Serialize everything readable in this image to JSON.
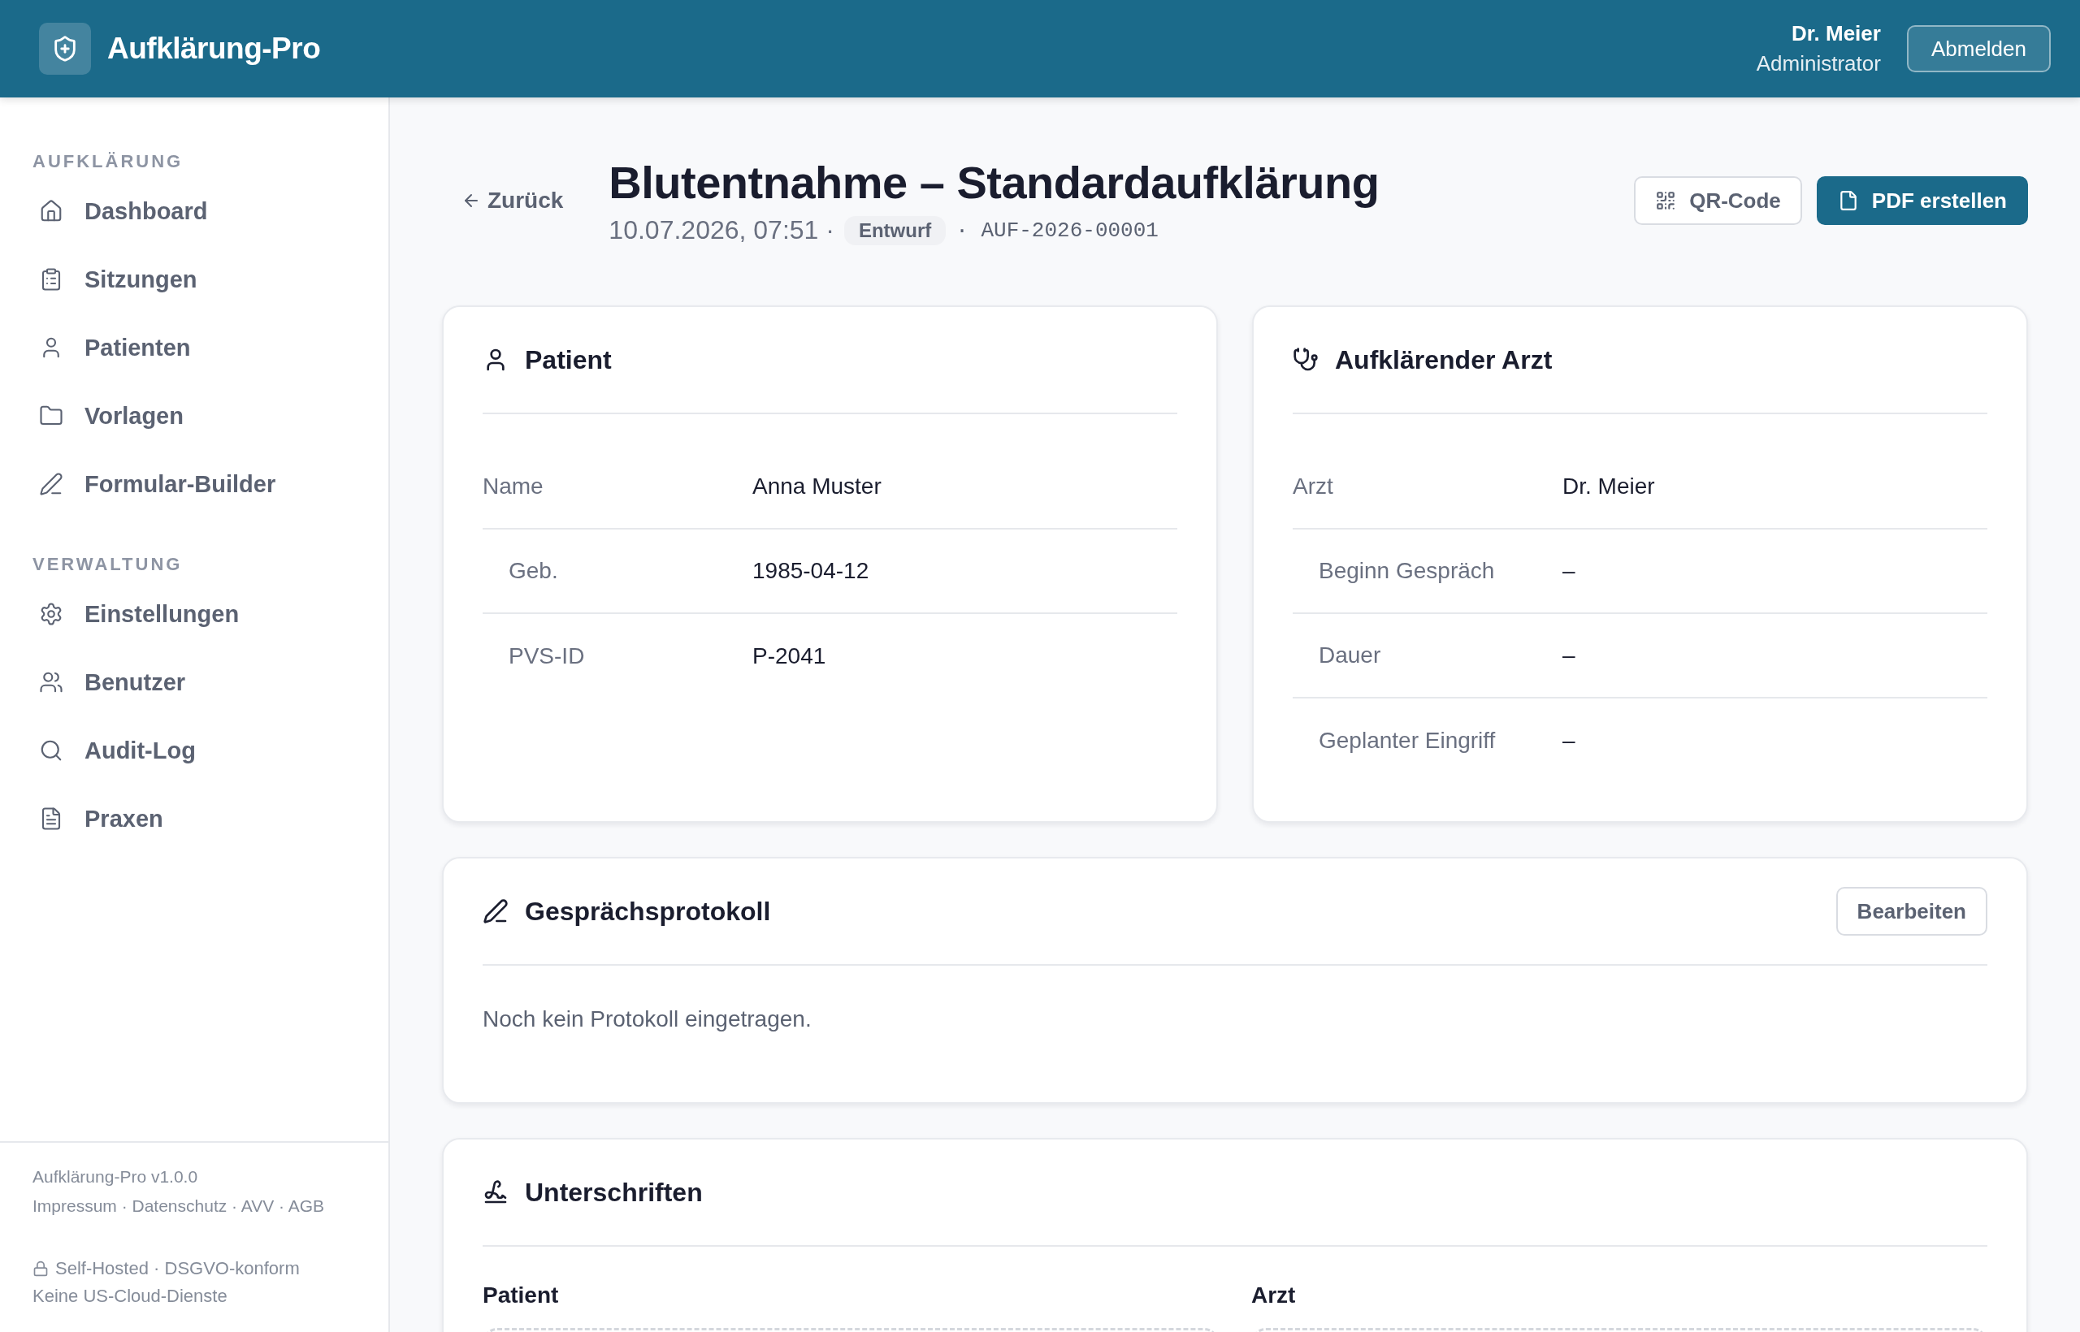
{
  "app": {
    "name": "Aufklärung-Pro"
  },
  "user": {
    "name": "Dr. Meier",
    "role": "Administrator",
    "logout": "Abmelden"
  },
  "sidebar": {
    "sections": [
      {
        "title": "AUFKLÄRUNG",
        "items": [
          {
            "label": "Dashboard",
            "selected": false
          },
          {
            "label": "Sitzungen",
            "selected": false
          },
          {
            "label": "Patienten",
            "selected": false
          },
          {
            "label": "Vorlagen",
            "selected": false
          },
          {
            "label": "Formular-Builder",
            "selected": false
          }
        ]
      },
      {
        "title": "VERWALTUNG",
        "items": [
          {
            "label": "Einstellungen",
            "selected": false
          },
          {
            "label": "Benutzer",
            "selected": false
          },
          {
            "label": "Audit-Log",
            "selected": false
          },
          {
            "label": "Praxen",
            "selected": false
          }
        ]
      }
    ],
    "footer": {
      "version": "Aufklärung-Pro v1.0.0",
      "links": "Impressum · Datenschutz · AVV · AGB",
      "note": "Self-Hosted · DSGVO-konform",
      "note_2": "Keine US-Cloud-Dienste"
    }
  },
  "page": {
    "back": "Zurück",
    "title": "Blutentnahme – Standardaufklärung",
    "meta_date": "10.07.2026, 07:51 ·",
    "status": "Entwurf",
    "meta_id": "· AUF-2026-00001",
    "actions": [
      {
        "label": "QR-Code",
        "kind": "secondary"
      },
      {
        "label": "PDF erstellen",
        "kind": "primary"
      }
    ]
  },
  "patient_card": {
    "title": "Patient",
    "rows": [
      {
        "label": "Name",
        "value": "Anna Muster",
        "indented": false
      },
      {
        "label": "Geb.",
        "value": "1985-04-12",
        "indented": true
      },
      {
        "label": "PVS-ID",
        "value": "P-2041",
        "indented": true
      }
    ]
  },
  "doctor_card": {
    "title": "Aufklärender Arzt",
    "rows": [
      {
        "label": "Arzt",
        "value": "Dr. Meier",
        "indented": false
      },
      {
        "label": "Beginn Gespräch",
        "value": "–",
        "indented": true
      },
      {
        "label": "Dauer",
        "value": "–",
        "indented": true
      },
      {
        "label": "Geplanter Eingriff",
        "value": "–",
        "indented": true
      }
    ]
  },
  "protocol_card": {
    "title": "Gesprächsprotokoll",
    "button": "Bearbeiten",
    "text": "Noch kein Protokoll eingetragen."
  },
  "signatures_card": {
    "title": "Unterschriften",
    "columns": [
      "Patient",
      "Arzt"
    ]
  }
}
